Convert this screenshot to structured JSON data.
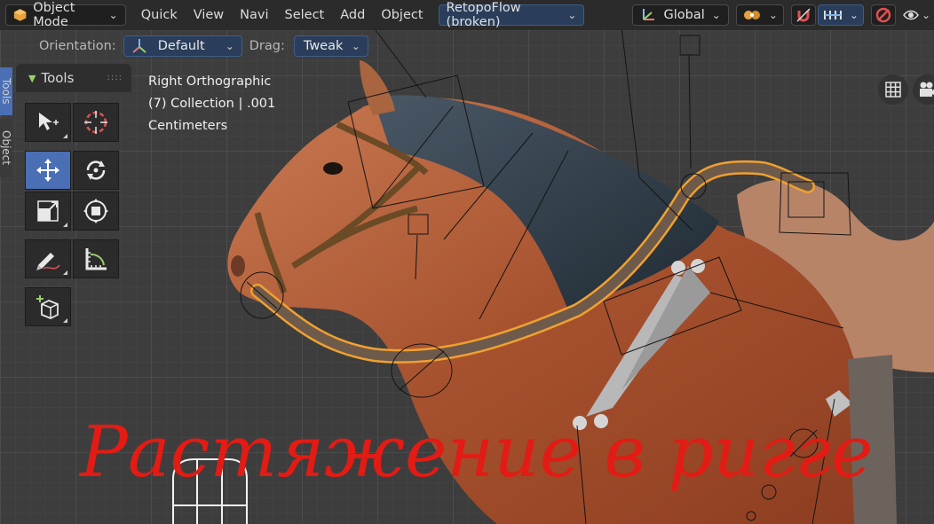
{
  "header": {
    "mode_label": "Object Mode",
    "menus": [
      "Quick",
      "View",
      "Navi",
      "Select",
      "Add",
      "Object"
    ],
    "addon_dropdown": "RetopoFlow (broken)",
    "transform_orientation": "Global"
  },
  "tool_settings": {
    "orientation_label": "Orientation:",
    "orientation_value": "Default",
    "drag_label": "Drag:",
    "drag_value": "Tweak"
  },
  "side_tabs": [
    "Tools",
    "Object"
  ],
  "toolbar": {
    "title": "Tools",
    "tools": [
      {
        "name": "select-box-tool",
        "icon": "cursor-select-icon",
        "active": false
      },
      {
        "name": "cursor-tool",
        "icon": "3d-cursor-icon",
        "active": false
      },
      {
        "name": "move-tool",
        "icon": "move-arrows-icon",
        "active": true
      },
      {
        "name": "rotate-tool",
        "icon": "rotate-icon",
        "active": false
      },
      {
        "name": "scale-tool",
        "icon": "scale-icon",
        "active": false
      },
      {
        "name": "transform-tool",
        "icon": "transform-icon",
        "active": false
      },
      {
        "name": "annotate-tool",
        "icon": "pencil-icon",
        "active": false
      },
      {
        "name": "measure-tool",
        "icon": "ruler-icon",
        "active": false
      },
      {
        "name": "add-cube-tool",
        "icon": "add-cube-icon",
        "active": false
      }
    ]
  },
  "viewport_info": {
    "view_name": "Right Orthographic",
    "collection": "(7) Collection | .001",
    "units": "Centimeters"
  },
  "overlay_title": "Растяжение в ригге",
  "colors": {
    "header_bg": "#2b2b2b",
    "active_tool": "#4a6fb5",
    "selection_outline": "#f0a030",
    "title_red": "#e21b14",
    "viewport_grid_bg": "#3d3d3d"
  }
}
